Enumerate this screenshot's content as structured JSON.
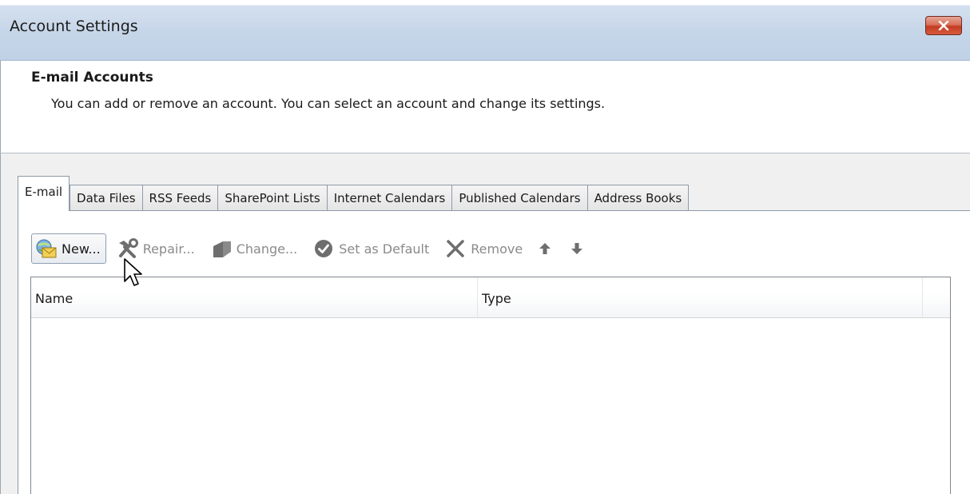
{
  "window": {
    "title": "Account Settings"
  },
  "header": {
    "section_title": "E-mail Accounts",
    "description": "You can add or remove an account. You can select an account and change its settings."
  },
  "tabs": [
    {
      "label": "E-mail",
      "active": true
    },
    {
      "label": "Data Files",
      "active": false
    },
    {
      "label": "RSS Feeds",
      "active": false
    },
    {
      "label": "SharePoint Lists",
      "active": false
    },
    {
      "label": "Internet Calendars",
      "active": false
    },
    {
      "label": "Published Calendars",
      "active": false
    },
    {
      "label": "Address Books",
      "active": false
    }
  ],
  "toolbar": {
    "new_label": "New...",
    "repair_label": "Repair...",
    "change_label": "Change...",
    "set_default_label": "Set as Default",
    "remove_label": "Remove",
    "icons": {
      "new": "new-mail-icon",
      "repair": "tools-icon",
      "change": "change-icon",
      "set_default": "checkmark-circle-icon",
      "remove": "x-icon",
      "move_up": "arrow-up-icon",
      "move_down": "arrow-down-icon"
    }
  },
  "list": {
    "columns": [
      "Name",
      "Type"
    ],
    "rows": []
  },
  "colors": {
    "titlebar": "#c6d6e9",
    "close_button": "#c43c23",
    "panel_bg": "#f0f0f0",
    "disabled_text": "#8a8a8a"
  }
}
